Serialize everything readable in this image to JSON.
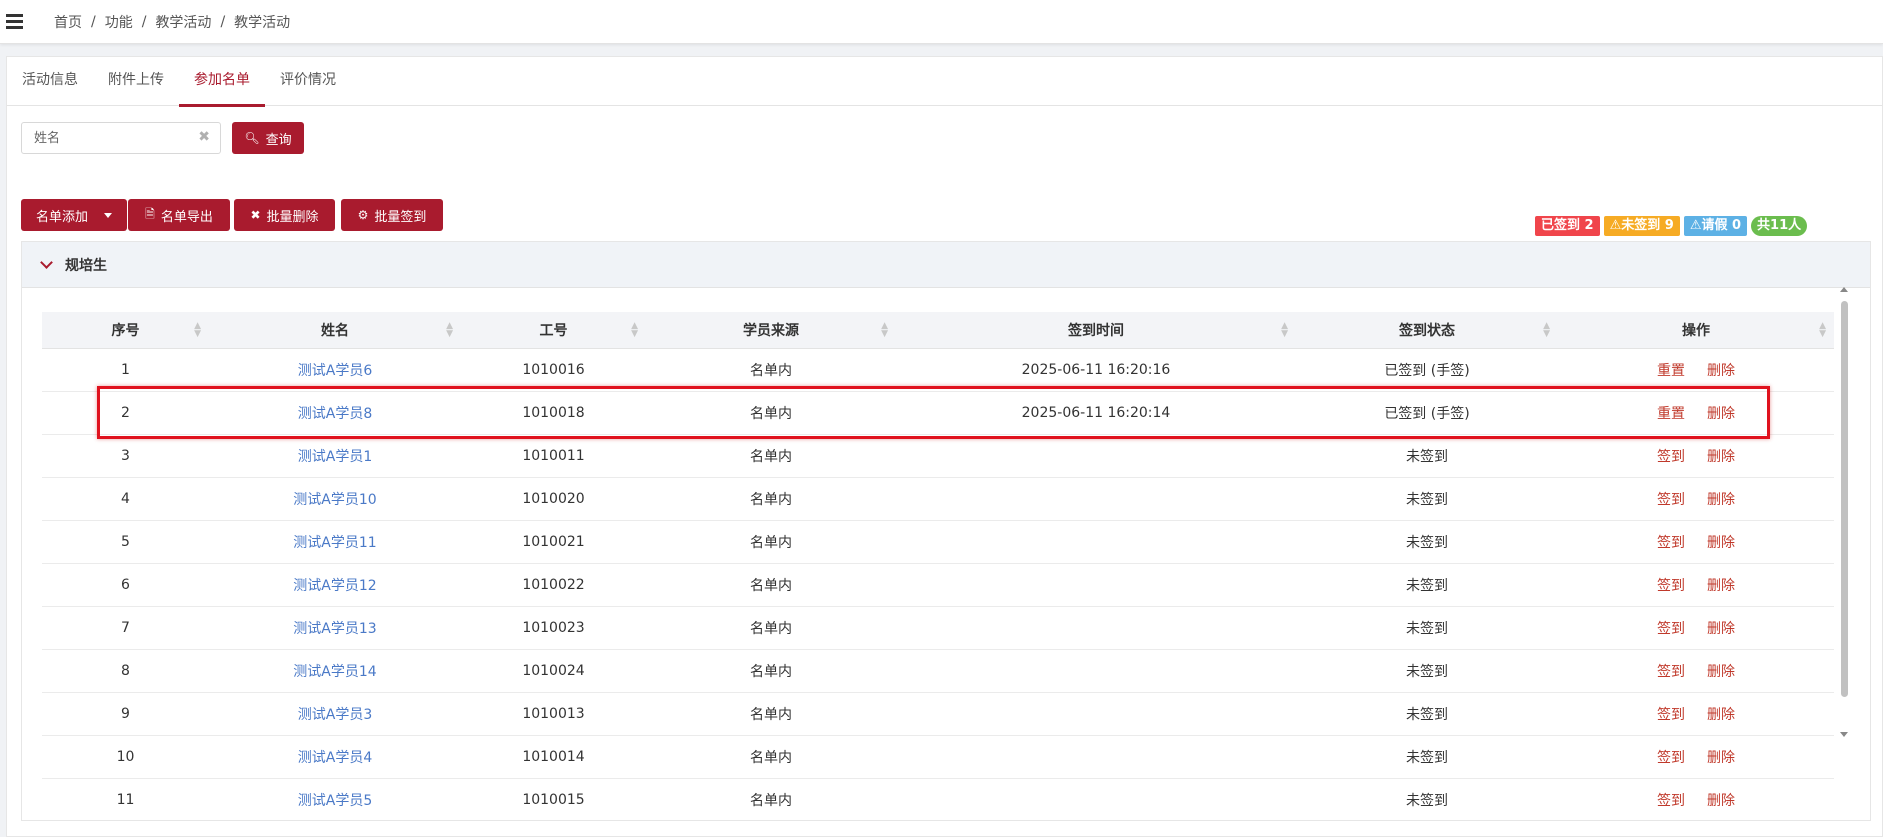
{
  "breadcrumb": [
    "首页",
    "功能",
    "教学活动",
    "教学活动"
  ],
  "tabs": [
    {
      "label": "活动信息",
      "active": false
    },
    {
      "label": "附件上传",
      "active": false
    },
    {
      "label": "参加名单",
      "active": true
    },
    {
      "label": "评价情况",
      "active": false
    }
  ],
  "search": {
    "placeholder": "姓名",
    "value": "",
    "button_label": "查询"
  },
  "toolbar": {
    "add_label": "名单添加",
    "export_label": "名单导出",
    "batch_delete_label": "批量删除",
    "batch_signin_label": "批量签到"
  },
  "summary": {
    "signed": "已签到 2",
    "unsigned": "⚠未签到 9",
    "leave": "⚠请假 0",
    "total": "共11人"
  },
  "panel": {
    "title": "规培生"
  },
  "table": {
    "columns": [
      "序号",
      "姓名",
      "工号",
      "学员来源",
      "签到时间",
      "签到状态",
      "操作"
    ],
    "rows": [
      {
        "index": "1",
        "name": "测试A学员6",
        "id": "1010016",
        "source": "名单内",
        "time": "2025-06-11 16:20:16",
        "status": "已签到 (手签)",
        "action1": "重置",
        "action2": "删除"
      },
      {
        "index": "2",
        "name": "测试A学员8",
        "id": "1010018",
        "source": "名单内",
        "time": "2025-06-11 16:20:14",
        "status": "已签到 (手签)",
        "action1": "重置",
        "action2": "删除"
      },
      {
        "index": "3",
        "name": "测试A学员1",
        "id": "1010011",
        "source": "名单内",
        "time": "",
        "status": "未签到",
        "action1": "签到",
        "action2": "删除"
      },
      {
        "index": "4",
        "name": "测试A学员10",
        "id": "1010020",
        "source": "名单内",
        "time": "",
        "status": "未签到",
        "action1": "签到",
        "action2": "删除"
      },
      {
        "index": "5",
        "name": "测试A学员11",
        "id": "1010021",
        "source": "名单内",
        "time": "",
        "status": "未签到",
        "action1": "签到",
        "action2": "删除"
      },
      {
        "index": "6",
        "name": "测试A学员12",
        "id": "1010022",
        "source": "名单内",
        "time": "",
        "status": "未签到",
        "action1": "签到",
        "action2": "删除"
      },
      {
        "index": "7",
        "name": "测试A学员13",
        "id": "1010023",
        "source": "名单内",
        "time": "",
        "status": "未签到",
        "action1": "签到",
        "action2": "删除"
      },
      {
        "index": "8",
        "name": "测试A学员14",
        "id": "1010024",
        "source": "名单内",
        "time": "",
        "status": "未签到",
        "action1": "签到",
        "action2": "删除"
      },
      {
        "index": "9",
        "name": "测试A学员3",
        "id": "1010013",
        "source": "名单内",
        "time": "",
        "status": "未签到",
        "action1": "签到",
        "action2": "删除"
      },
      {
        "index": "10",
        "name": "测试A学员4",
        "id": "1010014",
        "source": "名单内",
        "time": "",
        "status": "未签到",
        "action1": "签到",
        "action2": "删除"
      },
      {
        "index": "11",
        "name": "测试A学员5",
        "id": "1010015",
        "source": "名单内",
        "time": "",
        "status": "未签到",
        "action1": "签到",
        "action2": "删除"
      }
    ]
  },
  "colors": {
    "accent": "#a91b2e",
    "link": "#4a79c7",
    "highlight": "#e0121e"
  }
}
